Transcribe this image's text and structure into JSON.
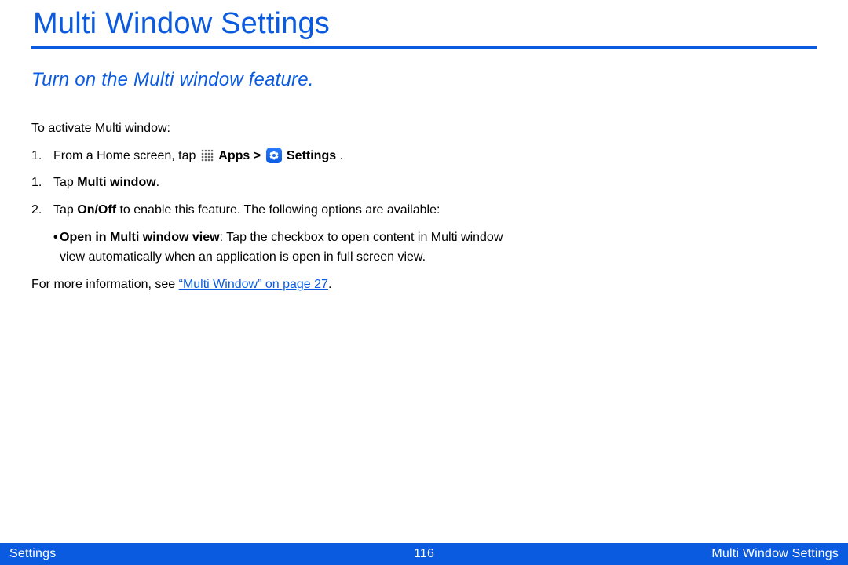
{
  "header": {
    "title": "Multi Window Settings"
  },
  "subtitle": "Turn on the Multi window feature.",
  "intro": "To activate Multi window:",
  "step1": {
    "num": "1.",
    "pre": "From a Home screen, tap ",
    "apps_label": "Apps",
    "gt": " > ",
    "settings_label": "Settings",
    "end": " ."
  },
  "step2": {
    "num": "1.",
    "pre": "Tap ",
    "bold": "Multi window",
    "post": "."
  },
  "step3": {
    "num": "2.",
    "pre": "Tap ",
    "bold": "On/Off",
    "post": " to enable this feature. The following options are available:"
  },
  "bullet": {
    "mark": "•",
    "bold": "Open in Multi window view",
    "post": ": Tap the checkbox to open content in Multi window view automatically when an application is open in full screen view."
  },
  "moreinfo": {
    "pre": "For more information, see ",
    "link": "“Multi Window” on page 27",
    "post": "."
  },
  "footer": {
    "left": "Settings",
    "center": "116",
    "right": "Multi Window Settings"
  },
  "colors": {
    "accent": "#0b5be0"
  }
}
